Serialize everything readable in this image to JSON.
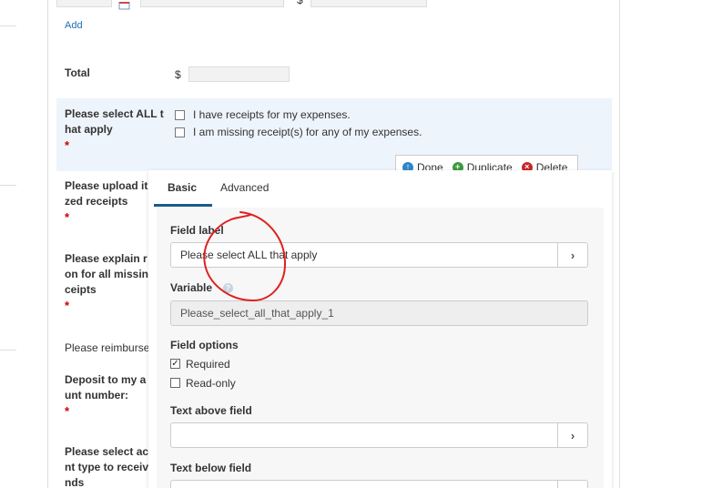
{
  "top_row": {
    "currency": "$"
  },
  "add_link": "Add",
  "total": {
    "label": "Total",
    "currency": "$"
  },
  "questions": {
    "select_all": {
      "label_line1": "Please select ALL t",
      "label_line2": "hat apply",
      "required": "*"
    },
    "upload": {
      "label_line1": "Please upload it",
      "label_line2": "zed receipts",
      "required": "*"
    },
    "explain": {
      "label_line1": "Please explain r",
      "label_line2": "on for all missin",
      "label_line3": "ceipts",
      "required": "*"
    },
    "reimburse": {
      "label": "Please reimburse"
    },
    "deposit": {
      "label_line1": "Deposit to my a",
      "label_line2": "unt number:",
      "required": "*"
    },
    "account_type": {
      "label_line1": "Please select ac",
      "label_line2": "nt type to receiv",
      "label_line3": "nds"
    }
  },
  "options": [
    {
      "label": "I have receipts for my expenses."
    },
    {
      "label": "I am missing receipt(s) for any of my expenses."
    }
  ],
  "toolbar": {
    "done": "Done",
    "duplicate": "Duplicate",
    "delete": "Delete"
  },
  "editor": {
    "tabs": [
      "Basic",
      "Advanced"
    ],
    "active_tab": "Basic",
    "field_label": {
      "label": "Field label",
      "value": "Please select ALL that apply"
    },
    "variable": {
      "label": "Variable",
      "value": "Please_select_all_that_apply_1"
    },
    "field_options": {
      "label": "Field options",
      "required": "Required",
      "required_checked": true,
      "read_only": "Read-only",
      "read_only_checked": false
    },
    "text_above": {
      "label": "Text above field",
      "value": ""
    },
    "text_below": {
      "label": "Text below field",
      "value": ""
    }
  },
  "colors": {
    "highlight_row": "#eef4fb",
    "required": "#cc0000",
    "done_icon": "#2f86c8",
    "duplicate_icon": "#3c9a3c",
    "delete_icon": "#c62828",
    "annotation": "#e02020",
    "tab_underline": "#1b5b8a"
  },
  "icons": {
    "calendar": "calendar-icon",
    "done": "arrow-up-circle-icon",
    "duplicate": "plus-circle-icon",
    "delete": "x-circle-icon",
    "chevron": "chevron-right-icon",
    "help": "question-circle-icon"
  }
}
